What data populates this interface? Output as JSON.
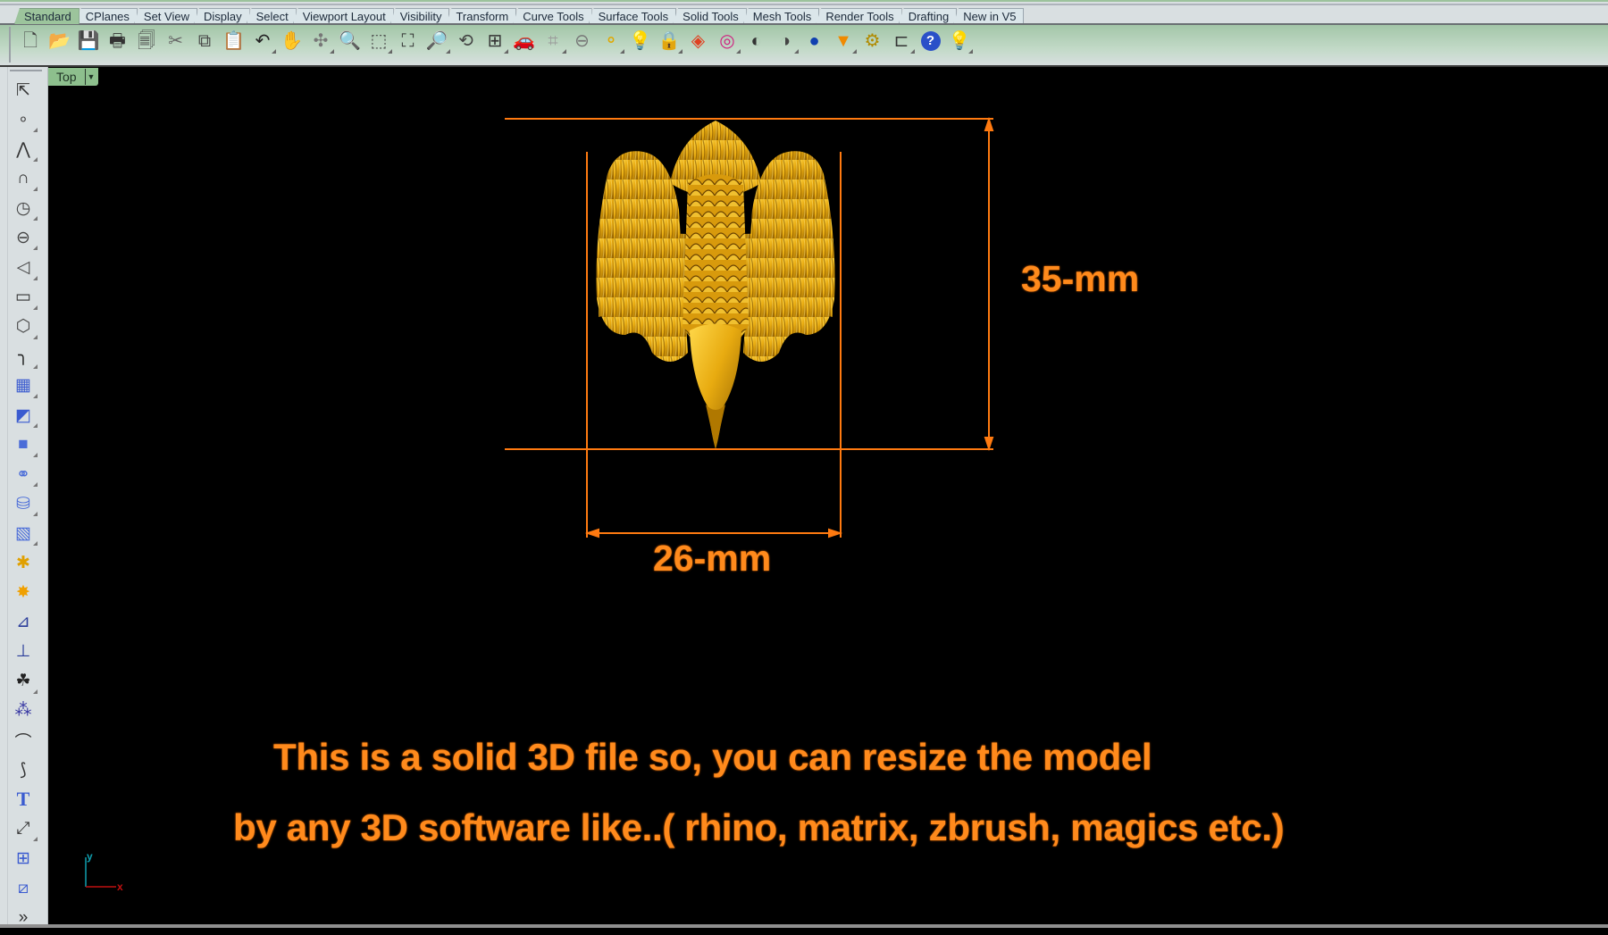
{
  "toolbar_tabs": [
    {
      "label": "Standard",
      "active": true
    },
    {
      "label": "CPlanes"
    },
    {
      "label": "Set View"
    },
    {
      "label": "Display"
    },
    {
      "label": "Select"
    },
    {
      "label": "Viewport Layout"
    },
    {
      "label": "Visibility"
    },
    {
      "label": "Transform"
    },
    {
      "label": "Curve Tools"
    },
    {
      "label": "Surface Tools"
    },
    {
      "label": "Solid Tools"
    },
    {
      "label": "Mesh Tools"
    },
    {
      "label": "Render Tools"
    },
    {
      "label": "Drafting"
    },
    {
      "label": "New in V5"
    }
  ],
  "standard_tools": [
    {
      "name": "new-file-icon",
      "glyph": "🗋",
      "color": "#444444"
    },
    {
      "name": "open-folder-icon",
      "glyph": "📂",
      "color": "#e0a800"
    },
    {
      "name": "save-icon",
      "glyph": "💾",
      "color": "#8a7a20"
    },
    {
      "name": "print-icon",
      "glyph": "🖶",
      "color": "#333333"
    },
    {
      "name": "document-properties-icon",
      "glyph": "🗐",
      "color": "#444444"
    },
    {
      "name": "cut-icon",
      "glyph": "✂",
      "color": "#666666"
    },
    {
      "name": "copy-icon",
      "glyph": "⧉",
      "color": "#444444"
    },
    {
      "name": "paste-icon",
      "glyph": "📋",
      "color": "#c8b400"
    },
    {
      "name": "undo-icon",
      "glyph": "↶",
      "color": "#222222"
    },
    {
      "name": "pan-hand-icon",
      "glyph": "✋",
      "color": "#555555"
    },
    {
      "name": "rotate-view-icon",
      "glyph": "✣",
      "color": "#777777"
    },
    {
      "name": "zoom-in-out-icon",
      "glyph": "🔍",
      "color": "#444444"
    },
    {
      "name": "zoom-window-icon",
      "glyph": "⬚",
      "color": "#444444"
    },
    {
      "name": "zoom-extents-icon",
      "glyph": "⛶",
      "color": "#333333"
    },
    {
      "name": "zoom-selected-icon",
      "glyph": "🔎",
      "color": "#c8b400"
    },
    {
      "name": "undo-view-change-icon",
      "glyph": "⟲",
      "color": "#444444"
    },
    {
      "name": "four-viewports-icon",
      "glyph": "⊞",
      "color": "#333333"
    },
    {
      "name": "car-options-icon",
      "glyph": "🚗",
      "color": "#d02020"
    },
    {
      "name": "grid-snap-icon",
      "glyph": "⌗",
      "color": "#9a9a9a"
    },
    {
      "name": "osnap-icon",
      "glyph": "⊖",
      "color": "#777777"
    },
    {
      "name": "select-filter-icon",
      "glyph": "⚬",
      "color": "#e0a800"
    },
    {
      "name": "light-bulb-icon",
      "glyph": "💡",
      "color": "#888888"
    },
    {
      "name": "lock-icon",
      "glyph": "🔒",
      "color": "#555555"
    },
    {
      "name": "layer-icon",
      "glyph": "◈",
      "color": "#e04020"
    },
    {
      "name": "color-wheel-icon",
      "glyph": "◎",
      "color": "#d02080"
    },
    {
      "name": "shaded-sphere-icon",
      "glyph": "◐",
      "color": "#333333"
    },
    {
      "name": "rendered-sphere-icon",
      "glyph": "◑",
      "color": "#444444"
    },
    {
      "name": "render-icon",
      "glyph": "●",
      "color": "#1040b0"
    },
    {
      "name": "spotlight-icon",
      "glyph": "▼",
      "color": "#f08a00"
    },
    {
      "name": "gear-options-icon",
      "glyph": "⚙",
      "color": "#b08a00"
    },
    {
      "name": "dimension-icon",
      "glyph": "⊏",
      "color": "#333333"
    },
    {
      "name": "help-icon",
      "glyph": "?",
      "color": "#ffffff"
    },
    {
      "name": "bulb-toggle-icon",
      "glyph": "💡",
      "color": "#888888"
    }
  ],
  "left_tools": [
    {
      "name": "select-arrow-icon",
      "glyph": "⇱",
      "color": "#333333",
      "flyout": false
    },
    {
      "name": "point-icon",
      "glyph": "∘",
      "color": "#444444",
      "flyout": true
    },
    {
      "name": "polyline-icon",
      "glyph": "⋀",
      "color": "#333333",
      "flyout": true
    },
    {
      "name": "curve-control-points-icon",
      "glyph": "∩",
      "color": "#333333",
      "flyout": true
    },
    {
      "name": "circle-icon",
      "glyph": "◷",
      "color": "#444444",
      "flyout": true
    },
    {
      "name": "ellipse-icon",
      "glyph": "⊖",
      "color": "#444444",
      "flyout": true
    },
    {
      "name": "arc-icon",
      "glyph": "◁",
      "color": "#444444",
      "flyout": true
    },
    {
      "name": "rectangle-icon",
      "glyph": "▭",
      "color": "#333333",
      "flyout": true
    },
    {
      "name": "polygon-icon",
      "glyph": "⬡",
      "color": "#444444",
      "flyout": true
    },
    {
      "name": "fillet-curve-icon",
      "glyph": "╮",
      "color": "#222222",
      "flyout": true
    },
    {
      "name": "surface-from-points-icon",
      "glyph": "▦",
      "color": "#3a5bd0",
      "flyout": true
    },
    {
      "name": "extrude-surface-icon",
      "glyph": "◩",
      "color": "#3a5bd0",
      "flyout": true
    },
    {
      "name": "box-solid-icon",
      "glyph": "■",
      "color": "#4a6cd8",
      "flyout": true
    },
    {
      "name": "boolean-union-icon",
      "glyph": "⚭",
      "color": "#4a6cd8",
      "flyout": true
    },
    {
      "name": "cylinder-icon",
      "glyph": "⛁",
      "color": "#4a6cd8",
      "flyout": true
    },
    {
      "name": "mesh-icon",
      "glyph": "▧",
      "color": "#4a6cd8",
      "flyout": true
    },
    {
      "name": "puzzle-join-icon",
      "glyph": "✱",
      "color": "#e0a000",
      "flyout": false
    },
    {
      "name": "explode-icon",
      "glyph": "✸",
      "color": "#f0a000",
      "flyout": false
    },
    {
      "name": "trim-icon",
      "glyph": "⊿",
      "color": "#2a3c9a",
      "flyout": false
    },
    {
      "name": "split-icon",
      "glyph": "⊥",
      "color": "#2a3c9a",
      "flyout": false
    },
    {
      "name": "group-icon",
      "glyph": "☘",
      "color": "#222222",
      "flyout": true
    },
    {
      "name": "ungroup-icon",
      "glyph": "⁂",
      "color": "#3030a0",
      "flyout": false
    },
    {
      "name": "edit-points-icon",
      "glyph": "⌒",
      "color": "#333333",
      "flyout": false
    },
    {
      "name": "offset-curve-icon",
      "glyph": "⟆",
      "color": "#333333",
      "flyout": false
    },
    {
      "name": "text-tool-icon",
      "glyph": "T",
      "color": "#3a5bd0",
      "flyout": false
    },
    {
      "name": "move-icon",
      "glyph": "⤢",
      "color": "#333333",
      "flyout": true
    },
    {
      "name": "array-icon",
      "glyph": "⊞",
      "color": "#3a5bd0",
      "flyout": false
    },
    {
      "name": "orient-icon",
      "glyph": "⧄",
      "color": "#3a5bd0",
      "flyout": false
    },
    {
      "name": "more-tools-icon",
      "glyph": "»",
      "color": "#333333",
      "flyout": false
    }
  ],
  "viewport": {
    "name": "Top",
    "dropdown_glyph": "▼",
    "axis_x_label": "x",
    "axis_y_label": "y"
  },
  "annotations": {
    "height_dimension": "35-mm",
    "width_dimension": "26-mm",
    "note_line_1": "This is a solid 3D file so, you can resize the model",
    "note_line_2": "by any 3D software like..( rhino, matrix, zbrush, magics etc.)"
  },
  "colors": {
    "dimension_orange": "#ff7a10",
    "model_gold": "#e8b012",
    "viewport_tab_green": "#8dbf8d",
    "axis_x_red": "#c01010",
    "axis_y_cyan": "#10a0b0"
  }
}
